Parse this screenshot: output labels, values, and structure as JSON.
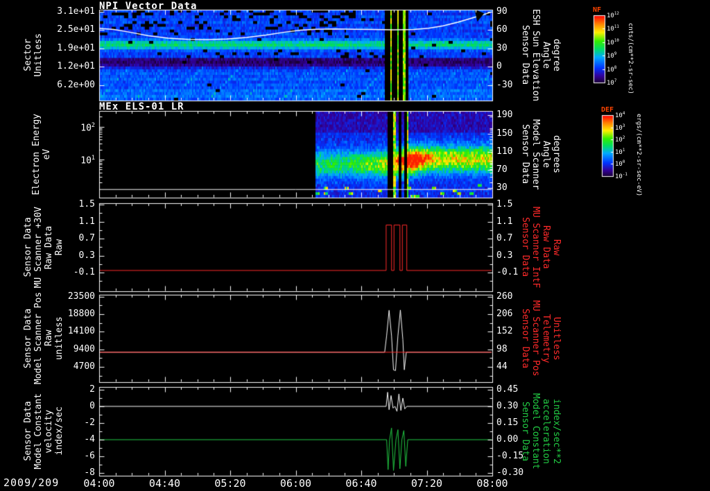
{
  "date_label": "2009/209",
  "chart_data": {
    "type": "heatmap",
    "description": "Five stacked time-series panels: NPI sector spectrogram, MEx ELS-01 LR electron energy spectrogram, and three line plots of scanner raw/telemetry/model values vs time",
    "x_axis": {
      "range_hours": [
        4,
        8
      ],
      "tick_labels": [
        "04:00",
        "04:40",
        "05:20",
        "06:00",
        "06:40",
        "07:20",
        "08:00"
      ],
      "tick_hours": [
        4,
        4.6667,
        5.3333,
        6,
        6.6667,
        7.3333,
        8
      ],
      "minor_tick_minutes": 10
    },
    "panels": [
      {
        "kind": "spectrogram",
        "title": "NPI Vector Data",
        "left_label_lines": [
          "Sector",
          "Unitless"
        ],
        "left_ticks": [
          {
            "label": "3.1e+01",
            "frac": 0.023
          },
          {
            "label": "2.5e+01",
            "frac": 0.225
          },
          {
            "label": "1.9e+01",
            "frac": 0.427
          },
          {
            "label": "1.2e+01",
            "frac": 0.629
          },
          {
            "label": "6.2e+00",
            "frac": 0.831
          }
        ],
        "right_label_lines": [
          "Sensor Data",
          "ESH Sun Elevation",
          "Angle",
          "degree"
        ],
        "right_label_color": "#ffffff",
        "right_ticks": [
          {
            "label": "90",
            "frac": 0.023
          },
          {
            "label": "60",
            "frac": 0.225
          },
          {
            "label": "30",
            "frac": 0.427
          },
          {
            "label": "0",
            "frac": 0.629
          },
          {
            "label": "-30",
            "frac": 0.831
          }
        ],
        "right_scale": {
          "v0": 90,
          "f0": 0.023,
          "v1": -30,
          "f1": 0.831
        },
        "overlay_line": {
          "name": "ESH Sun Elevation Angle",
          "color": "#ffffff",
          "axis": "right",
          "width": 1.5,
          "points": [
            [
              4,
              63
            ],
            [
              4.15,
              61
            ],
            [
              4.3,
              57
            ],
            [
              4.5,
              51
            ],
            [
              4.7,
              47
            ],
            [
              4.9,
              45
            ],
            [
              5.1,
              44.5
            ],
            [
              5.3,
              45.5
            ],
            [
              5.5,
              48
            ],
            [
              5.7,
              52
            ],
            [
              5.9,
              57
            ],
            [
              6.05,
              60
            ],
            [
              6.2,
              61.5
            ],
            [
              6.4,
              62
            ],
            [
              6.6,
              61.5
            ],
            [
              6.8,
              61
            ],
            [
              7,
              60.5
            ],
            [
              7.2,
              61
            ],
            [
              7.35,
              63
            ],
            [
              7.5,
              67
            ],
            [
              7.65,
              73
            ],
            [
              7.8,
              80
            ],
            [
              7.9,
              85
            ],
            [
              8,
              90
            ]
          ]
        },
        "gap_marker": {
          "t": 7.84,
          "v": 84
        },
        "heatmap": {
          "rows": 32,
          "seed": 7,
          "noise": 0.12,
          "row_profile": [
            0.24,
            0.22,
            0.25,
            0.23,
            0.26,
            0.22,
            0.24,
            0.21,
            0.25,
            0.23,
            0.3,
            0.44,
            0.5,
            0.4,
            0.26,
            0.22,
            0.24,
            0.07,
            0.05,
            0.08,
            0.18,
            0.24,
            0.27,
            0.25,
            0.28,
            0.24,
            0.27,
            0.25,
            0.3,
            0.28,
            0.31,
            0.27
          ],
          "stripes": [
            {
              "t0": 6.9,
              "t1": 6.95,
              "type": "black"
            },
            {
              "t0": 6.95,
              "t1": 6.975,
              "type": "bright"
            },
            {
              "t0": 6.975,
              "t1": 7.02,
              "type": "black"
            },
            {
              "t0": 7.02,
              "t1": 7.045,
              "type": "bright"
            },
            {
              "t0": 7.045,
              "t1": 7.085,
              "type": "black"
            },
            {
              "t0": 7.085,
              "t1": 7.105,
              "type": "bright"
            },
            {
              "t0": 7.105,
              "t1": 7.14,
              "type": "black"
            }
          ]
        }
      },
      {
        "kind": "spectrogram",
        "title": "MEx ELS-01 LR",
        "left_label_lines": [
          "Electron Energy",
          "eV"
        ],
        "left_ticks": [
          {
            "base": "10",
            "exp": "2",
            "frac": 0.18
          },
          {
            "base": "10",
            "exp": "1",
            "frac": 0.56
          }
        ],
        "right_label_lines": [
          "Sensor Data",
          "Model Scanner",
          "Angle",
          "degrees"
        ],
        "right_label_color": "#ffffff",
        "right_ticks": [
          {
            "label": "190",
            "frac": 0.05
          },
          {
            "label": "150",
            "frac": 0.26
          },
          {
            "label": "110",
            "frac": 0.47
          },
          {
            "label": "70",
            "frac": 0.68
          },
          {
            "label": "30",
            "frac": 0.89
          }
        ],
        "right_scale": {
          "v0": 190,
          "f0": 0.05,
          "v1": 30,
          "f1": 0.89
        },
        "overlay_line": {
          "name": "Model Scanner Angle",
          "color": "#ffffff",
          "axis": "right",
          "width": 1,
          "points": [
            [
              4,
              27
            ],
            [
              8,
              27
            ]
          ]
        },
        "heatmap": {
          "rows": 32,
          "seed": 13,
          "start_t": 6.2,
          "band_center_frac": 0.62,
          "band_sigma": 0.105,
          "blob": {
            "t": 7.17,
            "t_sigma": 0.11,
            "frac": 0.56,
            "frac_sigma": 0.09,
            "amp": 0.42
          },
          "stripes": [
            {
              "t0": 6.93,
              "t1": 6.99,
              "type": "black"
            },
            {
              "t0": 6.99,
              "t1": 7.015,
              "type": "bright"
            },
            {
              "t0": 7.04,
              "t1": 7.07,
              "type": "black"
            },
            {
              "t0": 7.09,
              "t1": 7.12,
              "type": "black"
            },
            {
              "t0": 7.12,
              "t1": 7.14,
              "type": "bright"
            }
          ]
        }
      },
      {
        "kind": "line",
        "left_label_lines": [
          "Sensor Data",
          "MU Scanner +30V",
          "Raw Data",
          "Raw"
        ],
        "left_ticks": [
          {
            "label": "1.5",
            "frac": 0.016
          },
          {
            "label": "1.1",
            "frac": 0.209
          },
          {
            "label": "0.7",
            "frac": 0.402
          },
          {
            "label": "0.3",
            "frac": 0.595
          },
          {
            "label": "-0.1",
            "frac": 0.788
          }
        ],
        "left_scale": {
          "v0": 1.5,
          "f0": 0.016,
          "v1": -0.1,
          "f1": 0.788
        },
        "right_label_lines": [
          "Sensor Data",
          "MU Scanner IntF",
          "Raw Data",
          "Raw"
        ],
        "right_label_color": "#ff2a2a",
        "right_ticks": [
          {
            "label": "1.5",
            "frac": 0.016
          },
          {
            "label": "1.1",
            "frac": 0.209
          },
          {
            "label": "0.7",
            "frac": 0.402
          },
          {
            "label": "0.3",
            "frac": 0.595
          },
          {
            "label": "-0.1",
            "frac": 0.788
          }
        ],
        "series": [
          {
            "name": "MU Scanner IntF Raw Data",
            "color": "#ff2a2a",
            "axis": "left",
            "points": [
              [
                4,
                -0.05
              ],
              [
                6.92,
                -0.05
              ],
              [
                6.92,
                1.02
              ],
              [
                6.975,
                1.02
              ],
              [
                6.975,
                -0.05
              ],
              [
                7,
                -0.05
              ],
              [
                7,
                1.02
              ],
              [
                7.06,
                1.02
              ],
              [
                7.06,
                -0.05
              ],
              [
                7.085,
                -0.05
              ],
              [
                7.085,
                1.02
              ],
              [
                7.13,
                1.02
              ],
              [
                7.13,
                -0.05
              ],
              [
                8,
                -0.05
              ]
            ]
          }
        ]
      },
      {
        "kind": "line",
        "left_label_lines": [
          "Sensor Data",
          "Model Scanner Pos",
          "Raw",
          "unitless"
        ],
        "left_ticks": [
          {
            "label": "23500",
            "frac": 0.02
          },
          {
            "label": "18800",
            "frac": 0.221
          },
          {
            "label": "14100",
            "frac": 0.422
          },
          {
            "label": "9400",
            "frac": 0.624
          },
          {
            "label": "4700",
            "frac": 0.825
          }
        ],
        "left_scale": {
          "v0": 23500,
          "f0": 0.02,
          "v1": 4700,
          "f1": 0.825
        },
        "right_label_lines": [
          "Sensor Data",
          "MU Scanner Pos",
          "Telemetry",
          "Unitless"
        ],
        "right_label_color": "#ff2a2a",
        "right_ticks": [
          {
            "label": "260",
            "frac": 0.02
          },
          {
            "label": "206",
            "frac": 0.221
          },
          {
            "label": "152",
            "frac": 0.422
          },
          {
            "label": "98",
            "frac": 0.624
          },
          {
            "label": "44",
            "frac": 0.825
          }
        ],
        "series": [
          {
            "name": "Model Scanner Pos Raw",
            "color": "#ffffff",
            "axis": "left",
            "points": [
              [
                4,
                8600
              ],
              [
                6.905,
                8600
              ],
              [
                6.925,
                13000
              ],
              [
                6.95,
                19800
              ],
              [
                6.975,
                13000
              ],
              [
                6.995,
                3900
              ],
              [
                7.015,
                3700
              ],
              [
                7.04,
                13000
              ],
              [
                7.065,
                19900
              ],
              [
                7.09,
                12000
              ],
              [
                7.105,
                3900
              ],
              [
                7.125,
                8600
              ],
              [
                8,
                8600
              ]
            ]
          },
          {
            "name": "MU Scanner Pos Telemetry",
            "color": "#ff2a2a",
            "axis": "left",
            "points": [
              [
                4,
                8600
              ],
              [
                8,
                8600
              ]
            ]
          }
        ]
      },
      {
        "kind": "line",
        "left_label_lines": [
          "Sensor Data",
          "Model Constant",
          "velocity",
          "index/sec"
        ],
        "left_ticks": [
          {
            "label": "2",
            "frac": 0.031
          },
          {
            "label": "0",
            "frac": 0.219
          },
          {
            "label": "-2",
            "frac": 0.406
          },
          {
            "label": "-4",
            "frac": 0.594
          },
          {
            "label": "-6",
            "frac": 0.781
          },
          {
            "label": "-8",
            "frac": 0.969
          }
        ],
        "left_scale": {
          "v0": 2,
          "f0": 0.031,
          "v1": -8,
          "f1": 0.969
        },
        "right_label_lines": [
          "Sensor Data",
          "Model Constant",
          "acceleration",
          "index/sec**2"
        ],
        "right_label_color": "#22cc44",
        "right_ticks": [
          {
            "label": "0.45",
            "frac": 0.031
          },
          {
            "label": "0.30",
            "frac": 0.219
          },
          {
            "label": "0.15",
            "frac": 0.406
          },
          {
            "label": "0.00",
            "frac": 0.594
          },
          {
            "label": "-0.15",
            "frac": 0.781
          },
          {
            "label": "-0.30",
            "frac": 0.969
          }
        ],
        "series": [
          {
            "name": "Model Constant velocity",
            "color": "#ffffff",
            "axis": "left",
            "points": [
              [
                4,
                0
              ],
              [
                6.92,
                0
              ],
              [
                6.935,
                1.7
              ],
              [
                6.95,
                -0.4
              ],
              [
                6.97,
                1.3
              ],
              [
                6.99,
                -0.2
              ],
              [
                7.01,
                0
              ],
              [
                7.03,
                -0.6
              ],
              [
                7.05,
                1.5
              ],
              [
                7.07,
                -0.5
              ],
              [
                7.09,
                1
              ],
              [
                7.11,
                -0.3
              ],
              [
                7.13,
                0
              ],
              [
                8,
                0
              ]
            ]
          },
          {
            "name": "Model Constant acceleration",
            "color": "#22cc44",
            "axis": "left",
            "points": [
              [
                4,
                -4
              ],
              [
                6.925,
                -4
              ],
              [
                6.94,
                -7.6
              ],
              [
                6.955,
                -4
              ],
              [
                6.975,
                -2.6
              ],
              [
                6.995,
                -7.7
              ],
              [
                7.02,
                -4
              ],
              [
                7.04,
                -2.8
              ],
              [
                7.06,
                -7.5
              ],
              [
                7.08,
                -4
              ],
              [
                7.1,
                -2.9
              ],
              [
                7.12,
                -7.2
              ],
              [
                7.14,
                -4
              ],
              [
                8,
                -4
              ]
            ]
          }
        ]
      }
    ],
    "colorbars": [
      {
        "name": "NF",
        "unit": "cnts/(cm**2-sr-sec)",
        "tick_base": "10",
        "tick_exponents": [
          "12",
          "11",
          "10",
          "9",
          "8",
          "7"
        ],
        "title_color": "#ff4400"
      },
      {
        "name": "DEF",
        "unit": "ergs/(cm**2-sr-sec-eV)",
        "tick_base": "10",
        "tick_exponents": [
          "4",
          "3",
          "2",
          "1",
          "0",
          "-1"
        ],
        "title_color": "#ff4400"
      }
    ]
  }
}
